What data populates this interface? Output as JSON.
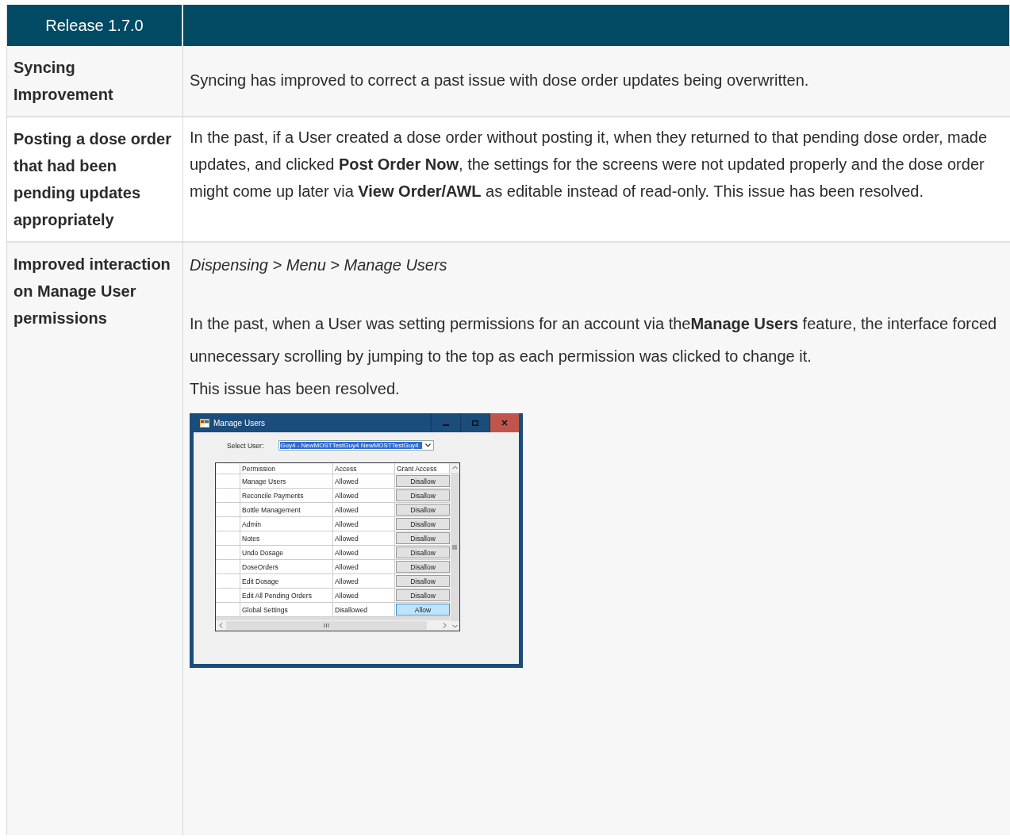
{
  "header": {
    "title": "Release 1.7.0"
  },
  "rows": [
    {
      "feature": "Syncing Improvement",
      "paragraphs": [
        "Syncing has improved to correct a past issue with dose order updates being overwritten."
      ]
    },
    {
      "feature": "Posting a dose order that had been pending updates appropriately",
      "paragraphs": [
        "In the past, if a User created a dose order without posting it, when they returned to that pending dose order, made updates, and clicked **Post Order Now**, the settings for the screens were not updated properly and the dose order might come up later via **View Order/AWL** as editable instead of read-only. This issue has been resolved."
      ]
    },
    {
      "feature": "Improved interaction on Manage User permissions",
      "path": "Dispensing > Menu > Manage Users",
      "paragraphs": [
        "In the past, when a User was setting permissions for an account via the**Manage Users** feature, the interface forced unnecessary scrolling by jumping to the top as each permission was clicked to change it.",
        "This issue has been resolved."
      ],
      "screenshot": {
        "title": "Manage Users",
        "select_label": "Select User:",
        "select_value": "Guy4 - NewMOSTTestGuy4 NewMOSTTestGuy4",
        "columns": [
          "Permission",
          "Access",
          "Grant Access"
        ],
        "permissions": [
          {
            "name": "Manage Users",
            "access": "Allowed",
            "action": "Disallow",
            "focused": false
          },
          {
            "name": "Reconcile Payments",
            "access": "Allowed",
            "action": "Disallow",
            "focused": false
          },
          {
            "name": "Bottle Management",
            "access": "Allowed",
            "action": "Disallow",
            "focused": false
          },
          {
            "name": "Admin",
            "access": "Allowed",
            "action": "Disallow",
            "focused": false
          },
          {
            "name": "Notes",
            "access": "Allowed",
            "action": "Disallow",
            "focused": false
          },
          {
            "name": "Undo Dosage",
            "access": "Allowed",
            "action": "Disallow",
            "focused": false
          },
          {
            "name": "DoseOrders",
            "access": "Allowed",
            "action": "Disallow",
            "focused": false
          },
          {
            "name": "Edit Dosage",
            "access": "Allowed",
            "action": "Disallow",
            "focused": false
          },
          {
            "name": "Edit All Pending Orders",
            "access": "Allowed",
            "action": "Disallow",
            "focused": false
          },
          {
            "name": "Global Settings",
            "access": "Disallowed",
            "action": "Allow",
            "focused": true
          }
        ]
      }
    }
  ]
}
